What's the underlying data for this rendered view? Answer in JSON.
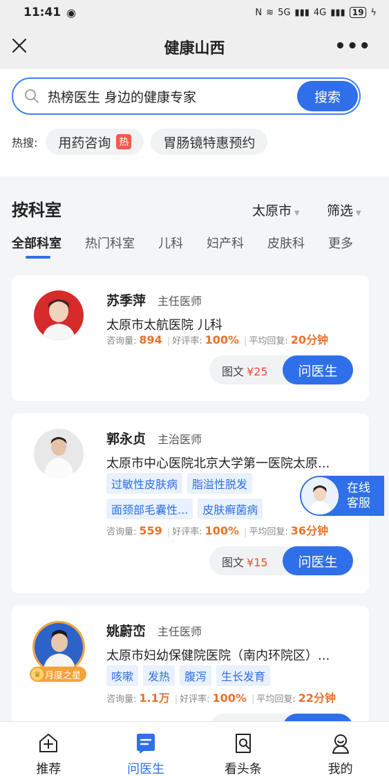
{
  "status_bar": {
    "time": "11:41",
    "network_1": "5G",
    "network_2": "4G",
    "battery": "19"
  },
  "nav": {
    "title": "健康山西"
  },
  "search": {
    "text": "热榜医生 身边的健康专家",
    "button": "搜索"
  },
  "hot_search": {
    "label": "热搜:",
    "items": [
      {
        "label": "用药咨询",
        "badge": "热"
      },
      {
        "label": "胃肠镜特惠预约",
        "badge": ""
      }
    ]
  },
  "department": {
    "title": "按科室",
    "city": "太原市",
    "filter": "筛选",
    "tabs": [
      "全部科室",
      "热门科室",
      "儿科",
      "妇产科",
      "皮肤科",
      "更多"
    ],
    "active_tab": 0
  },
  "stats_labels": {
    "consult": "咨询量:",
    "rating": "好评率:",
    "reply": "平均回复:"
  },
  "doctors": [
    {
      "name": "苏季萍",
      "title": "主任医师",
      "hospital": "太原市太航医院 儿科",
      "tags": [],
      "consult": "894",
      "rating": "100%",
      "reply": "20分钟",
      "price_label": "图文",
      "price": "¥25",
      "ask": "问医生"
    },
    {
      "name": "郭永贞",
      "title": "主治医师",
      "hospital": "太原市中心医院北京大学第一医院太原...",
      "tags": [
        "过敏性皮肤病",
        "脂溢性脱发",
        "面颈部毛囊性...",
        "皮肤癣菌病"
      ],
      "consult": "559",
      "rating": "100%",
      "reply": "36分钟",
      "price_label": "图文",
      "price": "¥15",
      "ask": "问医生"
    },
    {
      "name": "姚蔚峦",
      "title": "主任医师",
      "hospital": "太原市妇幼保健院医院（南内环院区）...",
      "tags": [
        "咳嗽",
        "发热",
        "腹泻",
        "生长发育"
      ],
      "consult": "1.1万",
      "rating": "100%",
      "reply": "22分钟",
      "badge": "月度之星"
    }
  ],
  "service": {
    "line1": "在线",
    "line2": "客服"
  },
  "bottom_nav": [
    {
      "label": "推荐",
      "icon": "plus-home-icon"
    },
    {
      "label": "问医生",
      "icon": "chat-doc-icon"
    },
    {
      "label": "看头条",
      "icon": "news-search-icon"
    },
    {
      "label": "我的",
      "icon": "user-icon"
    }
  ],
  "colors": {
    "accent": "#2f6fe9",
    "highlight": "#e8722a",
    "price": "#e8503a"
  }
}
